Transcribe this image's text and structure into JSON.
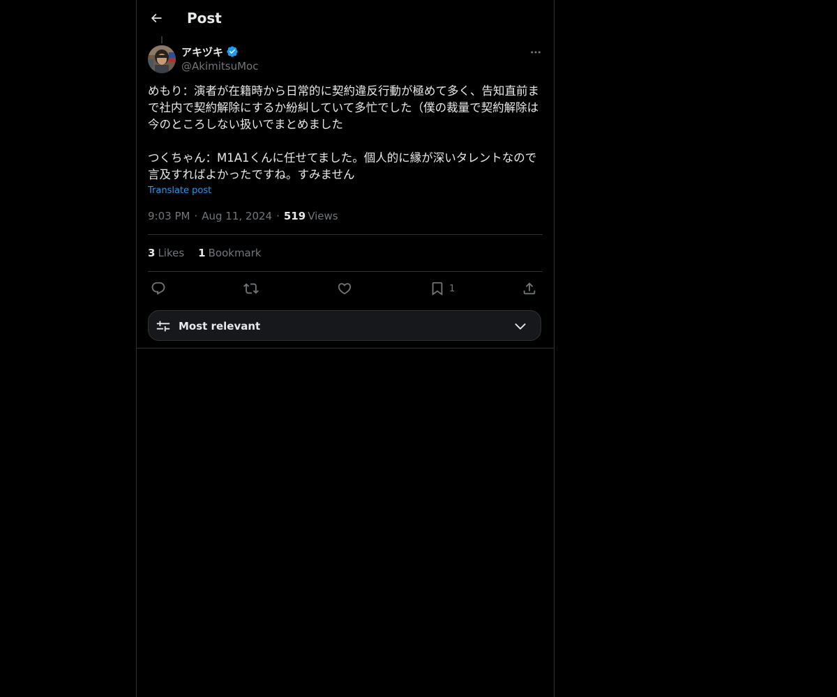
{
  "header": {
    "title": "Post",
    "back_icon": "arrow-left-icon"
  },
  "author": {
    "display_name": "アキヅキ",
    "handle": "@AkimitsuMoc",
    "verified": true,
    "verified_color": "#1d9bf0"
  },
  "post": {
    "text": "めもり：演者が在籍時から日常的に契約違反行動が極めて多く、告知直前まで社内で契約解除にするか紛糾していて多忙でした（僕の裁量で契約解除は今のところしない扱いでまとめました\n\nつくちゃん：M1A1くんに任せてました。個人的に縁が深いタレントなので言及すればよかったですね。すみません",
    "translate_label": "Translate post",
    "time": "9:03 PM",
    "date": "Aug 11, 2024",
    "views_count": "519",
    "views_label": "Views"
  },
  "stats": {
    "likes_count": "3",
    "likes_label": "Likes",
    "bookmarks_count": "1",
    "bookmarks_label": "Bookmark"
  },
  "actions": {
    "reply_icon": "reply-icon",
    "repost_icon": "repost-icon",
    "like_icon": "heart-icon",
    "bookmark_icon": "bookmark-icon",
    "bookmark_count": "1",
    "share_icon": "share-icon"
  },
  "sort": {
    "label": "Most relevant",
    "icon": "sliders-icon",
    "chevron": "chevron-down-icon"
  },
  "colors": {
    "background": "#000000",
    "text_primary": "#e7e9ea",
    "text_secondary": "#71767b",
    "accent": "#1d9bf0",
    "border": "#2f3336"
  }
}
